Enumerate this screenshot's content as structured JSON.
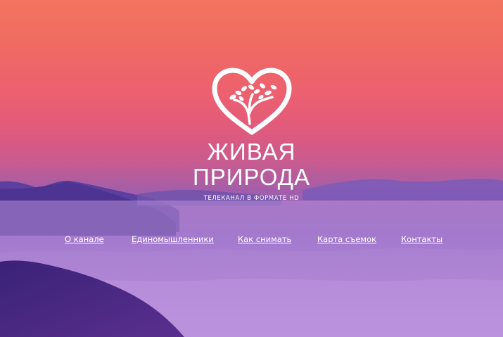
{
  "brand": {
    "title_line1": "ЖИВАЯ",
    "title_line2": "ПРИРОДА",
    "subtitle": "ТЕЛЕКАНАЛ В ФОРМАТЕ HD",
    "logo_icon": "heart-tree-icon"
  },
  "nav": {
    "items": [
      {
        "label": "О канале"
      },
      {
        "label": "Единомышленники"
      },
      {
        "label": "Как снимать"
      },
      {
        "label": "Карта съемок"
      },
      {
        "label": "Контакты"
      }
    ]
  },
  "colors": {
    "sky_top": "#f2745e",
    "sky_mid": "#e25a7c",
    "fog": "#9a6ccb",
    "mountain": "#4b2c86",
    "text": "#ffffff"
  }
}
